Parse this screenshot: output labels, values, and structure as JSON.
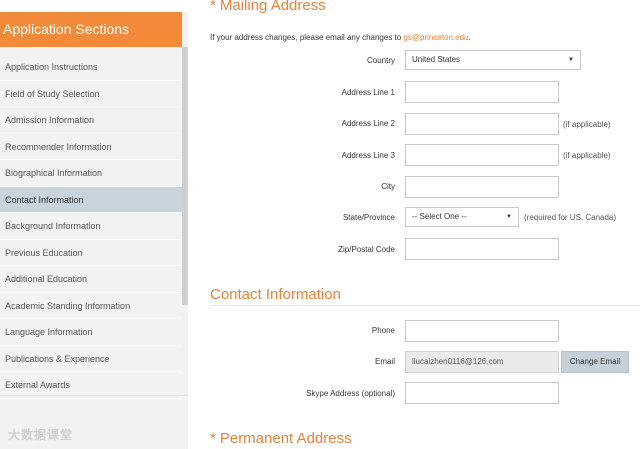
{
  "sidebar": {
    "header": "Application Sections",
    "items": [
      {
        "label": "Application Instructions"
      },
      {
        "label": "Field of Study Selection"
      },
      {
        "label": "Admission Information"
      },
      {
        "label": "Recommender Information"
      },
      {
        "label": "Biographical Information"
      },
      {
        "label": "Contact Information",
        "active": true
      },
      {
        "label": "Background Information"
      },
      {
        "label": "Previous Education"
      },
      {
        "label": "Additional Education"
      },
      {
        "label": "Academic Standing Information"
      },
      {
        "label": "Language Information"
      },
      {
        "label": "Publications & Experience"
      },
      {
        "label": "External Awards"
      }
    ]
  },
  "watermark": "大数据课堂",
  "mailing": {
    "title": "Mailing Address",
    "notice_text": "If your address changes, please email any changes to ",
    "notice_email": "gs@princeton.edu",
    "notice_end": ".",
    "country_label": "Country",
    "country_value": "United States",
    "line1_label": "Address Line 1",
    "line2_label": "Address Line 2",
    "line2_hint": "(if applicable)",
    "line3_label": "Address Line 3",
    "line3_hint": "(if applicable)",
    "city_label": "City",
    "state_label": "State/Province",
    "state_value": "-- Select One --",
    "state_hint": "(required for US, Canada)",
    "zip_label": "Zip/Postal Code"
  },
  "contact": {
    "title": "Contact Information",
    "phone_label": "Phone",
    "email_label": "Email",
    "email_value": "liucaizhen0116@126.com",
    "change_email_button": "Change Email",
    "skype_label": "Skype Address (optional)"
  },
  "permanent": {
    "title": "Permanent Address"
  },
  "colors": {
    "accent": "#e8833a",
    "header_bg": "#f28a3a",
    "active_item_bg": "#c9d3dc"
  }
}
